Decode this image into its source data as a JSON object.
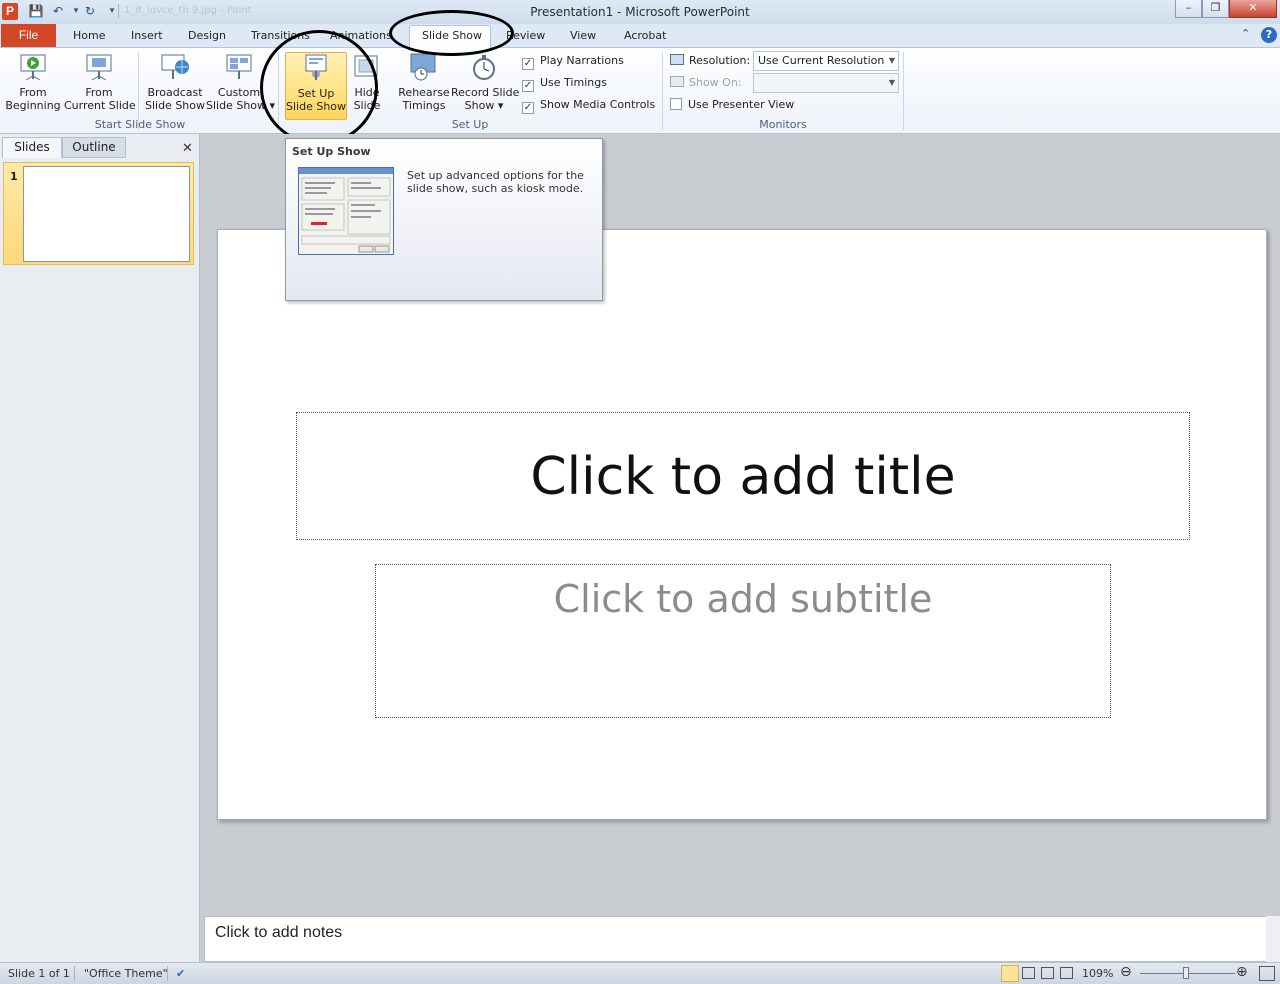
{
  "window": {
    "title": "Presentation1 - Microsoft PowerPoint",
    "minimize": "–",
    "restore": "❐",
    "close": "✕",
    "app_icon_letter": "P"
  },
  "quick_access": {
    "save": "💾",
    "undo": "↶",
    "redo": "↻",
    "more": "▾",
    "ghost_text": "1_it_lovce_th 9.jpg - Paint"
  },
  "tabs": {
    "file": "File",
    "items": [
      "Home",
      "Insert",
      "Design",
      "Transitions",
      "Animations",
      "Slide Show",
      "Review",
      "View",
      "Acrobat"
    ]
  },
  "ribbon": {
    "start_group": {
      "label": "Start Slide Show",
      "from_beginning": [
        "From",
        "Beginning"
      ],
      "from_current": [
        "From",
        "Current Slide"
      ],
      "broadcast": [
        "Broadcast",
        "Slide Show"
      ],
      "custom": [
        "Custom",
        "Slide Show ▾"
      ]
    },
    "setup_group": {
      "label": "Set Up",
      "setup_show": [
        "Set Up",
        "Slide Show"
      ],
      "hide_slide": [
        "Hide",
        "Slide"
      ],
      "rehearse": [
        "Rehearse",
        "Timings"
      ],
      "record": [
        "Record Slide",
        "Show ▾"
      ],
      "play_narrations": "Play Narrations",
      "use_timings": "Use Timings",
      "show_media_controls": "Show Media Controls",
      "check_mark": "✓"
    },
    "monitors_group": {
      "label": "Monitors",
      "resolution_label": "Resolution:",
      "resolution_value": "Use Current Resolution",
      "show_on_label": "Show On:",
      "show_on_value": "",
      "use_presenter_view": "Use Presenter View"
    }
  },
  "tooltip": {
    "title": "Set Up Show",
    "text": "Set up advanced options for the slide show, such as kiosk mode."
  },
  "left_pane": {
    "tab_slides": "Slides",
    "tab_outline": "Outline",
    "close": "✕",
    "slide_number": "1"
  },
  "slide": {
    "title_placeholder": "Click to add title",
    "subtitle_placeholder": "Click to add subtitle"
  },
  "notes": {
    "placeholder": "Click to add notes"
  },
  "status_bar": {
    "slide_info": "Slide 1 of 1",
    "theme": "\"Office Theme\"",
    "zoom": "109%",
    "zoom_out": "⊖",
    "zoom_in": "⊕"
  }
}
